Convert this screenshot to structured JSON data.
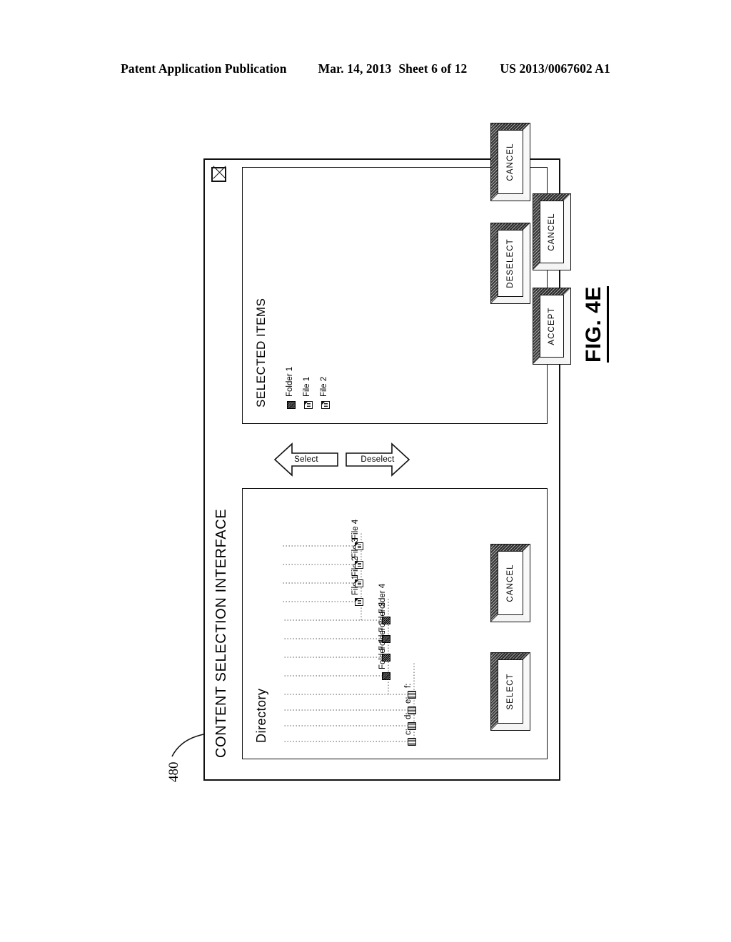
{
  "header": {
    "publication": "Patent Application Publication",
    "date": "Mar. 14, 2013",
    "sheet": "Sheet 6 of 12",
    "doc_number": "US 2013/0067602 A1"
  },
  "figure": {
    "label": "FIG. 4E",
    "reference_numeral": "480"
  },
  "window": {
    "title": "CONTENT SELECTION INTERFACE",
    "close_icon": "close-x-icon"
  },
  "directory_panel": {
    "title": "Directory",
    "tree": [
      {
        "label": "c:",
        "icon": "drive-icon",
        "level": 0
      },
      {
        "label": "d:",
        "icon": "drive-icon",
        "level": 0
      },
      {
        "label": "e:",
        "icon": "drive-icon",
        "level": 0
      },
      {
        "label": "f:",
        "icon": "drive-icon",
        "level": 0
      },
      {
        "label": "Folder 1",
        "icon": "folder-icon",
        "level": 1
      },
      {
        "label": "Folder 2",
        "icon": "folder-icon",
        "level": 1
      },
      {
        "label": "Folder 3",
        "icon": "folder-icon",
        "level": 1
      },
      {
        "label": "Folder 4",
        "icon": "folder-icon",
        "level": 1
      },
      {
        "label": "File 1",
        "icon": "file-icon",
        "level": 2
      },
      {
        "label": "File 2",
        "icon": "file-icon",
        "level": 2
      },
      {
        "label": "File 3",
        "icon": "file-icon",
        "level": 2
      },
      {
        "label": "File 4",
        "icon": "file-icon",
        "level": 2
      }
    ],
    "buttons": {
      "select": "SELECT",
      "cancel": "CANCEL"
    }
  },
  "selected_panel": {
    "title": "SELECTED ITEMS",
    "items": [
      {
        "label": "Folder 1",
        "icon": "folder-icon"
      },
      {
        "label": "File 1",
        "icon": "file-icon"
      },
      {
        "label": "File 2",
        "icon": "file-icon"
      }
    ],
    "buttons": {
      "deselect": "DESELECT",
      "cancel": "CANCEL"
    }
  },
  "transfer_arrows": {
    "select": "Select",
    "deselect": "Deselect"
  },
  "main_buttons": {
    "accept": "ACCEPT",
    "cancel": "CANCEL"
  }
}
